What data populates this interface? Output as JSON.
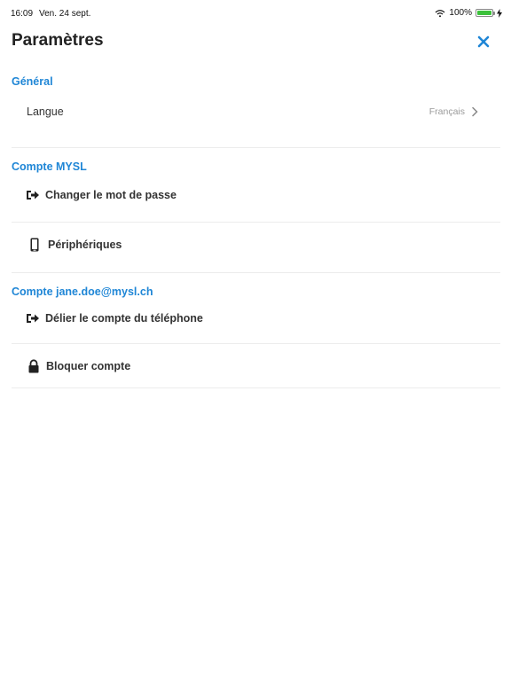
{
  "status_bar": {
    "time": "16:09",
    "date": "Ven. 24 sept.",
    "battery": "100%",
    "battery_level": 1.0
  },
  "header": {
    "title": "Paramètres"
  },
  "sections": [
    {
      "title": "Général",
      "items": [
        {
          "label": "Langue",
          "value": "Français"
        }
      ]
    },
    {
      "title": "Compte MYSL",
      "items": [
        {
          "label": "Changer le mot de passe",
          "icon": "sign-out-icon"
        },
        {
          "label": "Périphériques",
          "icon": "phone-icon"
        }
      ]
    },
    {
      "title": "Compte jane.doe@mysl.ch",
      "items": [
        {
          "label": "Délier le compte du téléphone",
          "icon": "sign-out-icon"
        },
        {
          "label": "Bloquer compte",
          "icon": "lock-icon"
        }
      ]
    }
  ],
  "colors": {
    "accent": "#1f86d6",
    "divider": "#ececec",
    "battery": "#3cc13b"
  }
}
